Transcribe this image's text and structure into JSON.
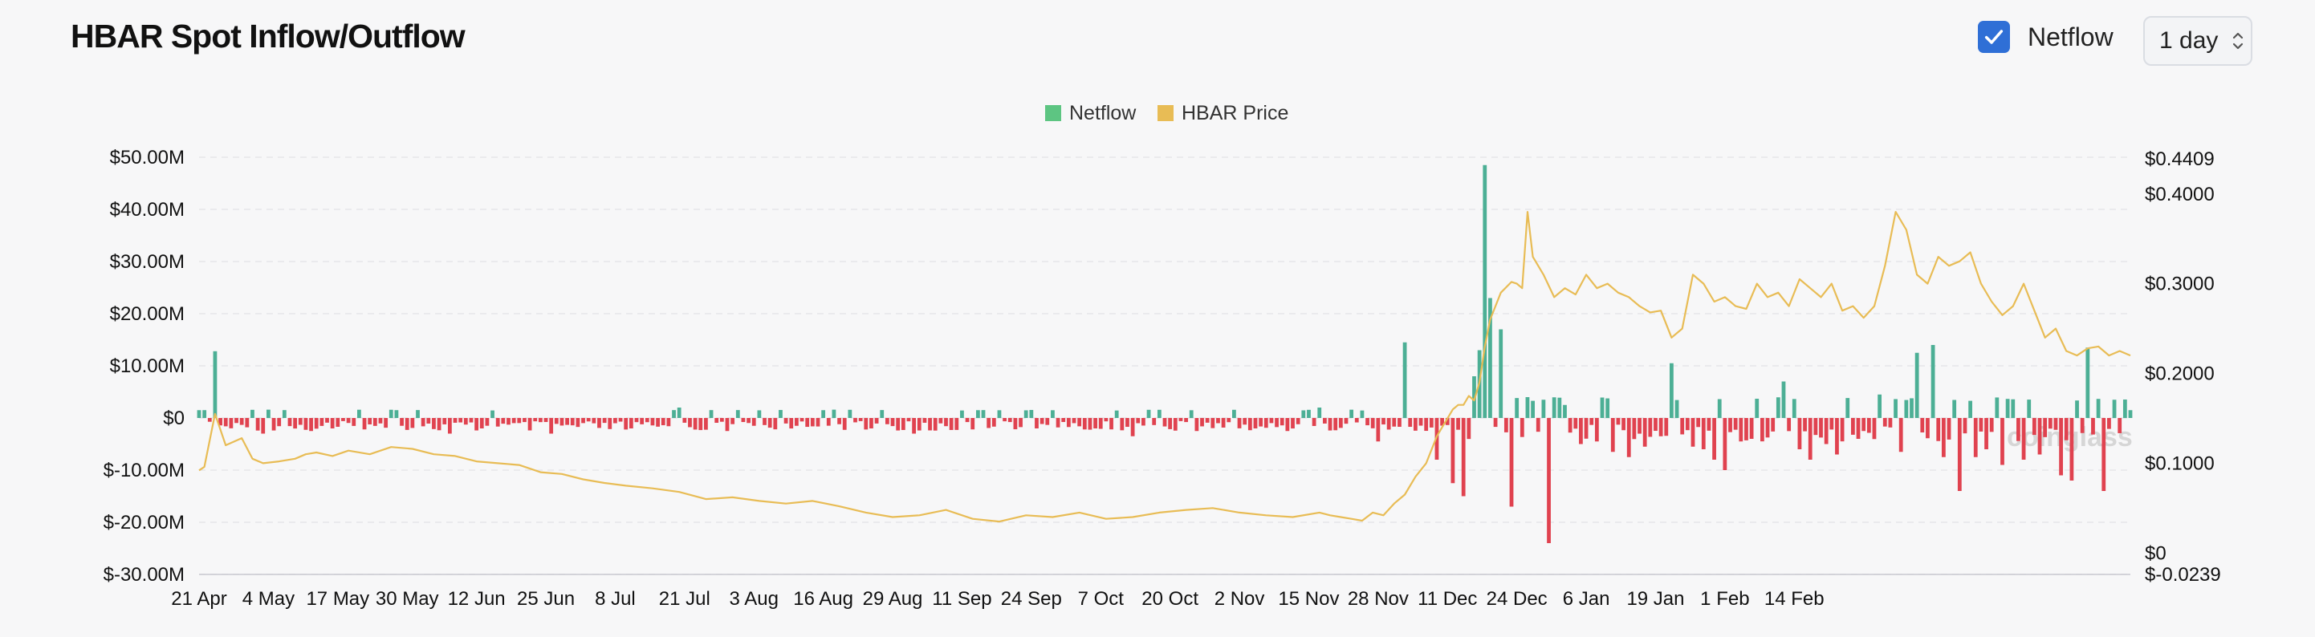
{
  "header": {
    "title": "HBAR Spot Inflow/Outflow",
    "netflow_toggle_label": "Netflow",
    "netflow_checked": true,
    "interval_value": "1 day"
  },
  "watermark": "coinglass",
  "colors": {
    "inflow": "#4caf95",
    "outflow": "#e0424f",
    "price": "#e8bc55",
    "legend_netflow": "#5dc582",
    "legend_price": "#e8bc55"
  },
  "chart_data": {
    "type": "bar",
    "legend": [
      {
        "name": "Netflow",
        "color": "#5dc582"
      },
      {
        "name": "HBAR Price",
        "color": "#e8bc55"
      }
    ],
    "x_tick_labels": [
      "21 Apr",
      "4 May",
      "17 May",
      "30 May",
      "12 Jun",
      "25 Jun",
      "8 Jul",
      "21 Jul",
      "3 Aug",
      "16 Aug",
      "29 Aug",
      "11 Sep",
      "24 Sep",
      "7 Oct",
      "20 Oct",
      "2 Nov",
      "15 Nov",
      "28 Nov",
      "11 Dec",
      "24 Dec",
      "6 Jan",
      "19 Jan",
      "1 Feb",
      "14 Feb"
    ],
    "y_left": {
      "tick_labels": [
        "$50.00M",
        "$40.00M",
        "$30.00M",
        "$20.00M",
        "$10.00M",
        "$0",
        "$-10.00M",
        "$-20.00M",
        "$-30.00M"
      ],
      "range": [
        -30,
        50
      ],
      "unit": "USD millions"
    },
    "y_right": {
      "tick_labels": [
        "$0.4409",
        "$0.4000",
        "$0.3000",
        "$0.2000",
        "$0.1000",
        "$0",
        "$-0.0239"
      ],
      "range": [
        -0.0239,
        0.4409
      ]
    },
    "netflow_series": {
      "name": "Netflow",
      "unit": "USD millions",
      "x_days": [
        0,
        3,
        12,
        21,
        25,
        38,
        47,
        53,
        66,
        81,
        90,
        99,
        104,
        112,
        126,
        134,
        146,
        157,
        168,
        175,
        187,
        198,
        204,
        210,
        221,
        226,
        232,
        235,
        237,
        239,
        240,
        241,
        242,
        244,
        246,
        249,
        252,
        253,
        256,
        259,
        262,
        265,
        268,
        271,
        276,
        280,
        282,
        284,
        286,
        289,
        291,
        297,
        300,
        302,
        305,
        307,
        312,
        315,
        319,
        322,
        325,
        327,
        330,
        333,
        335,
        338,
        342,
        345,
        349,
        351,
        354,
        357,
        359,
        362
      ],
      "values": [
        1.5,
        12.8,
        -3.0,
        -2.5,
        -2.0,
        -1.5,
        -3.0,
        -2.0,
        -3.0,
        -2.0,
        2.0,
        -2.5,
        -1.5,
        -1.5,
        -2.0,
        -3.0,
        1.5,
        -2.0,
        -2.0,
        -3.5,
        -2.5,
        -2.0,
        -2.5,
        2.0,
        -4.5,
        14.5,
        -8.0,
        -12.5,
        -15.0,
        8.0,
        13.0,
        48.5,
        23.0,
        17.0,
        -17.0,
        4.0,
        3.5,
        -24.0,
        2.5,
        -5.0,
        -4.5,
        -6.5,
        -7.5,
        -5.5,
        10.5,
        -5.5,
        -6.0,
        -8.0,
        -10.0,
        -4.5,
        -4.0,
        7.0,
        -6.0,
        -8.0,
        -5.0,
        -7.0,
        -2.5,
        4.5,
        -6.5,
        12.5,
        14.0,
        -7.5,
        -14.0,
        -7.5,
        -6.0,
        -9.0,
        -8.0,
        -7.0,
        -11.0,
        -12.0,
        13.5,
        -14.0,
        3.5,
        1.5
      ]
    },
    "price_series": {
      "name": "HBAR Price",
      "x_days": [
        0,
        1,
        3,
        5,
        8,
        10,
        12,
        15,
        18,
        20,
        22,
        25,
        28,
        32,
        36,
        40,
        44,
        48,
        52,
        56,
        60,
        64,
        68,
        72,
        76,
        80,
        85,
        90,
        95,
        100,
        105,
        110,
        115,
        120,
        125,
        130,
        135,
        140,
        145,
        150,
        155,
        160,
        165,
        170,
        175,
        180,
        185,
        190,
        195,
        200,
        205,
        210,
        212,
        214,
        216,
        218,
        220,
        222,
        224,
        226,
        228,
        230,
        232,
        233,
        234,
        235,
        236,
        237,
        238,
        239,
        240,
        241,
        242,
        244,
        246,
        247,
        248,
        249,
        250,
        252,
        254,
        256,
        258,
        260,
        262,
        264,
        266,
        268,
        270,
        272,
        274,
        276,
        278,
        280,
        282,
        284,
        286,
        288,
        290,
        292,
        294,
        296,
        298,
        300,
        302,
        304,
        306,
        308,
        310,
        312,
        314,
        316,
        318,
        320,
        322,
        324,
        326,
        328,
        330,
        332,
        334,
        336,
        338,
        340,
        342,
        344,
        346,
        348,
        350,
        352,
        354,
        356,
        358,
        360,
        362
      ],
      "values": [
        0.092,
        0.096,
        0.155,
        0.12,
        0.128,
        0.105,
        0.1,
        0.102,
        0.105,
        0.11,
        0.112,
        0.108,
        0.114,
        0.11,
        0.118,
        0.116,
        0.11,
        0.108,
        0.102,
        0.1,
        0.098,
        0.09,
        0.088,
        0.082,
        0.078,
        0.075,
        0.072,
        0.068,
        0.06,
        0.062,
        0.058,
        0.055,
        0.058,
        0.052,
        0.045,
        0.04,
        0.042,
        0.048,
        0.038,
        0.035,
        0.042,
        0.04,
        0.045,
        0.038,
        0.04,
        0.045,
        0.048,
        0.05,
        0.045,
        0.042,
        0.04,
        0.045,
        0.042,
        0.04,
        0.038,
        0.036,
        0.045,
        0.042,
        0.055,
        0.065,
        0.085,
        0.1,
        0.13,
        0.14,
        0.15,
        0.16,
        0.165,
        0.165,
        0.175,
        0.17,
        0.19,
        0.23,
        0.26,
        0.29,
        0.302,
        0.3,
        0.295,
        0.38,
        0.33,
        0.31,
        0.285,
        0.295,
        0.288,
        0.31,
        0.295,
        0.3,
        0.29,
        0.285,
        0.275,
        0.268,
        0.27,
        0.24,
        0.25,
        0.31,
        0.3,
        0.28,
        0.285,
        0.275,
        0.272,
        0.3,
        0.285,
        0.29,
        0.275,
        0.305,
        0.295,
        0.285,
        0.3,
        0.27,
        0.275,
        0.262,
        0.275,
        0.32,
        0.38,
        0.36,
        0.31,
        0.3,
        0.33,
        0.32,
        0.325,
        0.335,
        0.3,
        0.28,
        0.265,
        0.275,
        0.3,
        0.27,
        0.24,
        0.25,
        0.225,
        0.22,
        0.228,
        0.23,
        0.22,
        0.225,
        0.22
      ]
    },
    "grid": true,
    "legend_position": "top-center"
  }
}
